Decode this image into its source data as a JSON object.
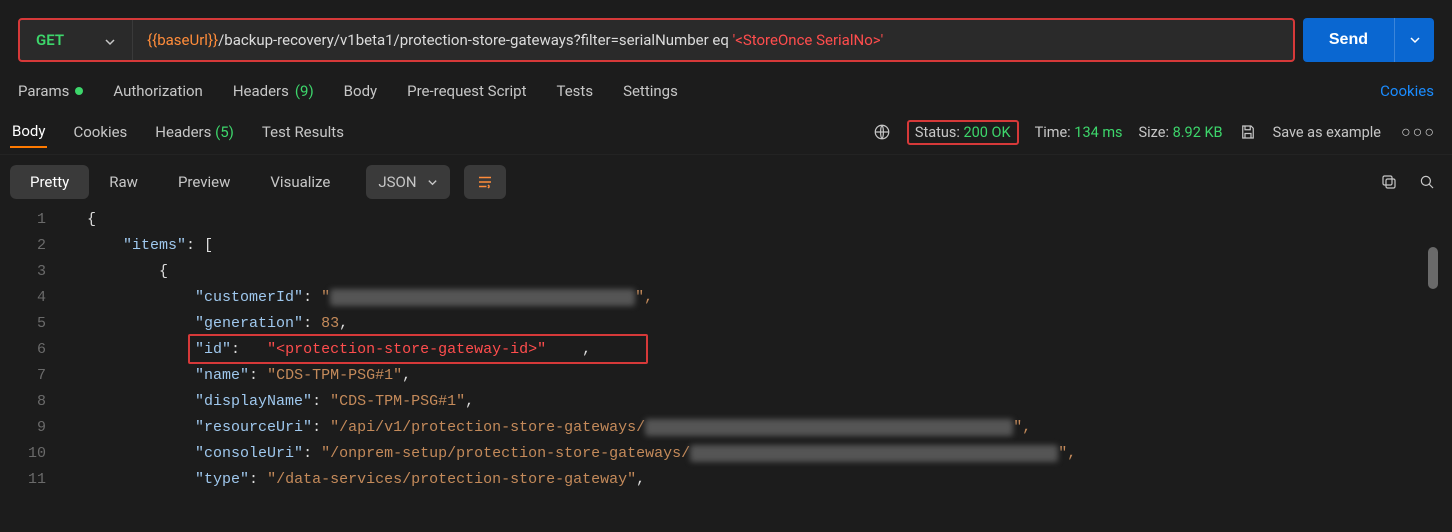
{
  "request": {
    "method": "GET",
    "url_var": "{{baseUrl}}",
    "url_path": "/backup-recovery/v1beta1/protection-store-gateways?filter=serialNumber eq ",
    "url_placeholder": "'<StoreOnce SerialNo>'",
    "send_label": "Send"
  },
  "req_tabs": {
    "params": "Params",
    "authorization": "Authorization",
    "headers": "Headers",
    "headers_count": "(9)",
    "body": "Body",
    "prerequest": "Pre-request Script",
    "tests": "Tests",
    "settings": "Settings",
    "cookies": "Cookies"
  },
  "resp_tabs": {
    "body": "Body",
    "cookies": "Cookies",
    "headers": "Headers",
    "headers_count": "(5)",
    "test_results": "Test Results"
  },
  "meta": {
    "status_label": "Status:",
    "status_value": "200 OK",
    "time_label": "Time:",
    "time_value": "134 ms",
    "size_label": "Size:",
    "size_value": "8.92 KB",
    "save_example": "Save as example"
  },
  "view_tabs": {
    "pretty": "Pretty",
    "raw": "Raw",
    "preview": "Preview",
    "visualize": "Visualize",
    "json": "JSON"
  },
  "code": {
    "l1": "{",
    "l2_key": "\"items\"",
    "l2_rest": ": [",
    "l3": "{",
    "l4_key": "\"customerId\"",
    "l4_val": "\"",
    "l4_blur": "xxxxxxxxxxxxxxxxxxxxxxxxxxxxxxxxx",
    "l4_end": "\",",
    "l5_key": "\"generation\"",
    "l5_val": "83",
    "l6_key": "\"id\"",
    "l6_val": "\"<protection-store-gateway-id>\"",
    "l7_key": "\"name\"",
    "l7_val": "\"CDS-TPM-PSG#1\"",
    "l8_key": "\"displayName\"",
    "l8_val": "\"CDS-TPM-PSG#1\"",
    "l9_key": "\"resourceUri\"",
    "l9_val": "\"/api/v1/protection-store-gateways/",
    "l9_blur": "xxxxxxxxxxxxxxxxxxxxxxxxxxxxxxxxxxxxxxxx",
    "l9_end": "\",",
    "l10_key": "\"consoleUri\"",
    "l10_val": "\"/onprem-setup/protection-store-gateways/",
    "l10_blur": "xxxxxxxxxxxxxxxxxxxxxxxxxxxxxxxxxxxxxxxx",
    "l10_end": "\",",
    "l11_key": "\"type\"",
    "l11_val": "\"/data-services/protection-store-gateway\""
  },
  "line_numbers": [
    "1",
    "2",
    "3",
    "4",
    "5",
    "6",
    "7",
    "8",
    "9",
    "10",
    "11"
  ]
}
